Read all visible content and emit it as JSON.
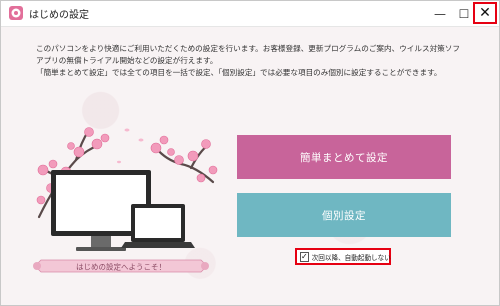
{
  "window": {
    "title": "はじめの設定",
    "minimize_glyph": "—",
    "maximize_glyph": "☐",
    "close_glyph": "✕"
  },
  "description": [
    "このパソコンをより快適にご利用いただくための設定を行います。お客様登録、更新プログラムのご案内、ウイルス対策ソフ",
    "アプリの無償トライアル開始などの設定が行えます。",
    "「簡単まとめて設定」では全ての項目を一括で設定、「個別設定」では必要な項目のみ個別に設定することができます。"
  ],
  "illustration": {
    "ribbon_text": "はじめの設定へようこそ！"
  },
  "buttons": {
    "easy_setup": "簡単まとめて設定",
    "custom_setup": "個別設定"
  },
  "startup_checkbox": {
    "label": "次回以降、自動起動しない",
    "checked": true,
    "check_glyph": "✓"
  },
  "colors": {
    "easy_button": "#c8649a",
    "custom_button": "#6fb7c2",
    "highlight_border": "#e60012"
  }
}
